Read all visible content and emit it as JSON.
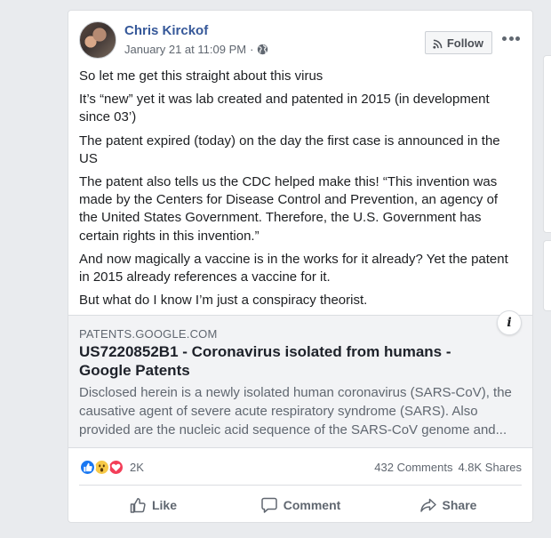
{
  "post": {
    "author": "Chris Kirckof",
    "timestamp": "January 21 at 11:09 PM",
    "separator": "·",
    "privacy_icon": "globe-icon",
    "follow_label": "Follow",
    "paragraphs": [
      "So let me get this straight about this virus",
      "It’s “new” yet it was lab created and patented in 2015 (in development since 03’)",
      "The patent expired (today) on the day the first case is announced in the US",
      "The patent also tells us the CDC helped make this! “This invention was made by the Centers for Disease Control and Prevention, an agency of the United States Government. Therefore, the U.S. Government has certain rights in this invention.”",
      "And now magically a vaccine is in the works for it already? Yet the patent in 2015 already references a vaccine for it.",
      "But what do I know I’m just a conspiracy theorist."
    ]
  },
  "link_preview": {
    "domain": "PATENTS.GOOGLE.COM",
    "title": "US7220852B1 - Coronavirus isolated from humans - Google Patents",
    "description": "Disclosed herein is a newly isolated human coronavirus (SARS-CoV), the causative agent of severe acute respiratory syndrome (SARS). Also provided are the nucleic acid sequence of the SARS-CoV genome and...",
    "info_label": "i"
  },
  "engagement": {
    "reaction_icons": [
      "like-reaction-icon",
      "wow-reaction-icon",
      "love-reaction-icon"
    ],
    "reaction_count": "2K",
    "comments": "432 Comments",
    "shares": "4.8K Shares"
  },
  "actions": {
    "like": "Like",
    "comment": "Comment",
    "share": "Share"
  },
  "colors": {
    "author_link": "#365899",
    "like_blue": "#1877f2",
    "wow_yellow": "#f7c948",
    "love_red": "#f33e58",
    "muted_text": "#606770"
  }
}
